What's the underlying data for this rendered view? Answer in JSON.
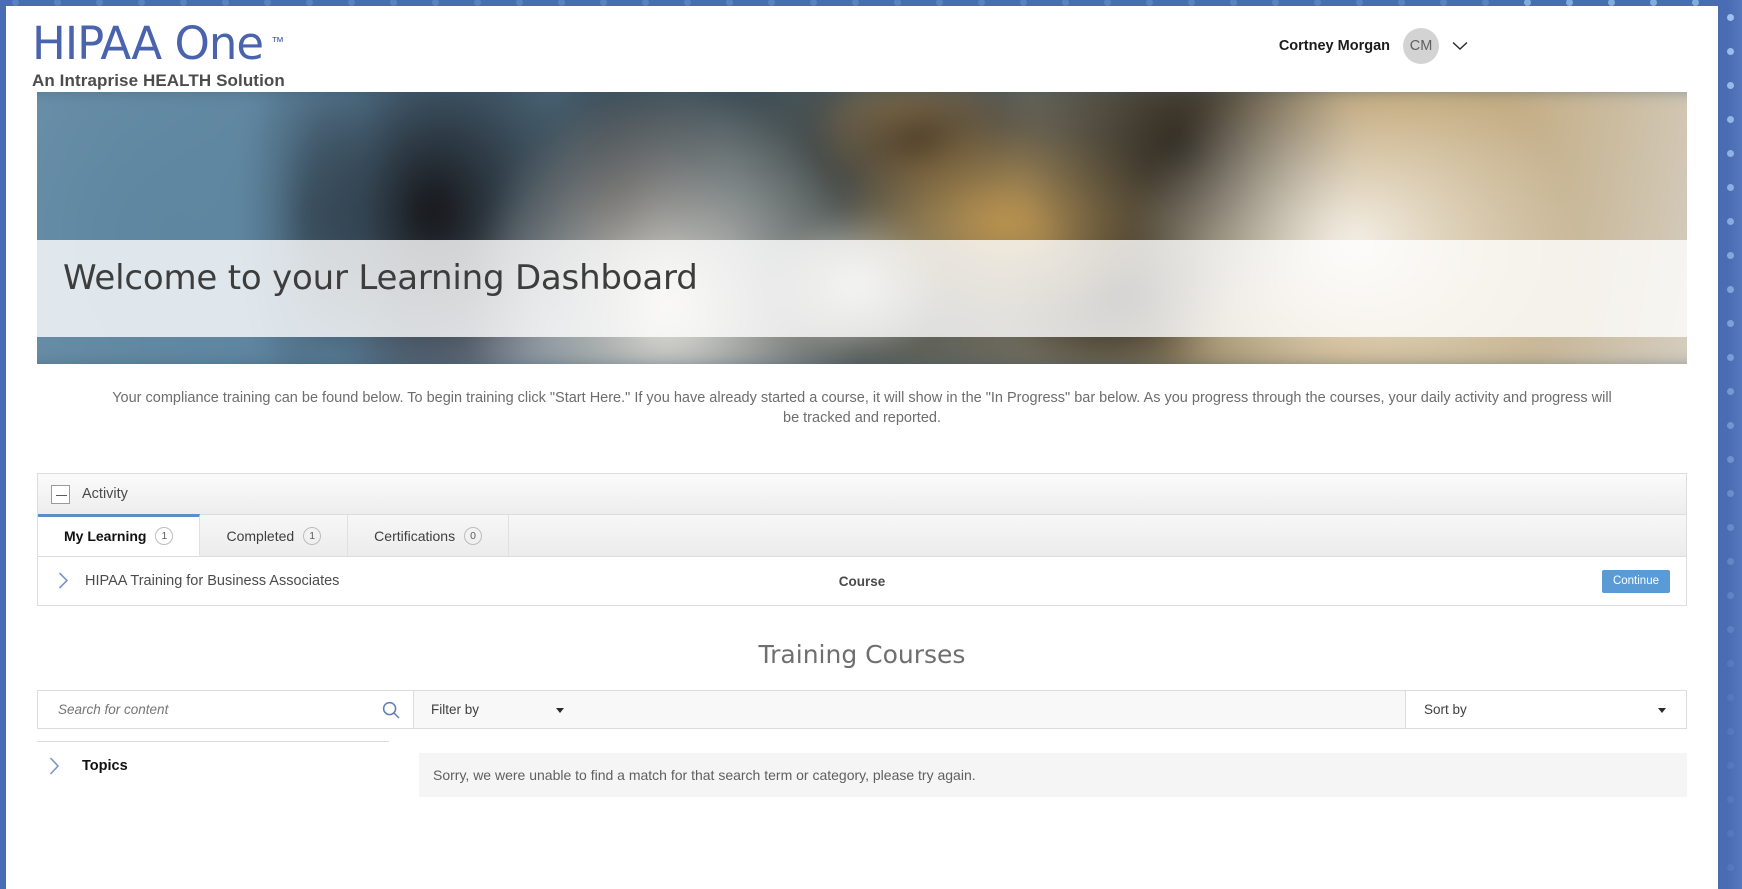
{
  "brand": {
    "logo_text": "HIPAA One",
    "logo_tm": "™",
    "tagline": "An Intraprise HEALTH Solution",
    "logo_color": "#4a63ae"
  },
  "header": {
    "user_name": "Cortney Morgan",
    "avatar_initials": "CM",
    "caret_icon": "chevron-down-icon"
  },
  "hero": {
    "title": "Welcome to your Learning Dashboard"
  },
  "intro": {
    "text": "Your compliance training can be found below. To begin training click \"Start Here.\" If you have already started a course, it will show in the \"In Progress\" bar below. As you progress through the courses, your daily activity and progress will be tracked and reported."
  },
  "activity": {
    "panel_title": "Activity",
    "collapse_icon": "minus-icon",
    "tabs": [
      {
        "label": "My Learning",
        "count": "1",
        "active": true
      },
      {
        "label": "Completed",
        "count": "1",
        "active": false
      },
      {
        "label": "Certifications",
        "count": "0",
        "active": false
      }
    ],
    "rows": [
      {
        "expand_icon": "chevron-right-icon",
        "name": "HIPAA Training for Business Associates",
        "type": "Course",
        "action_label": "Continue",
        "action_color": "#5b9bd5"
      }
    ]
  },
  "training": {
    "section_title": "Training Courses",
    "search": {
      "placeholder": "Search for content",
      "value": "",
      "icon": "search-icon"
    },
    "filter": {
      "label": "Filter by",
      "caret_icon": "caret-down-icon"
    },
    "sort": {
      "label": "Sort by",
      "caret_icon": "caret-down-icon"
    },
    "topics": {
      "label": "Topics",
      "expand_icon": "chevron-right-icon"
    },
    "empty_message": "Sorry, we were unable to find a match for that search term or category, please try again."
  }
}
